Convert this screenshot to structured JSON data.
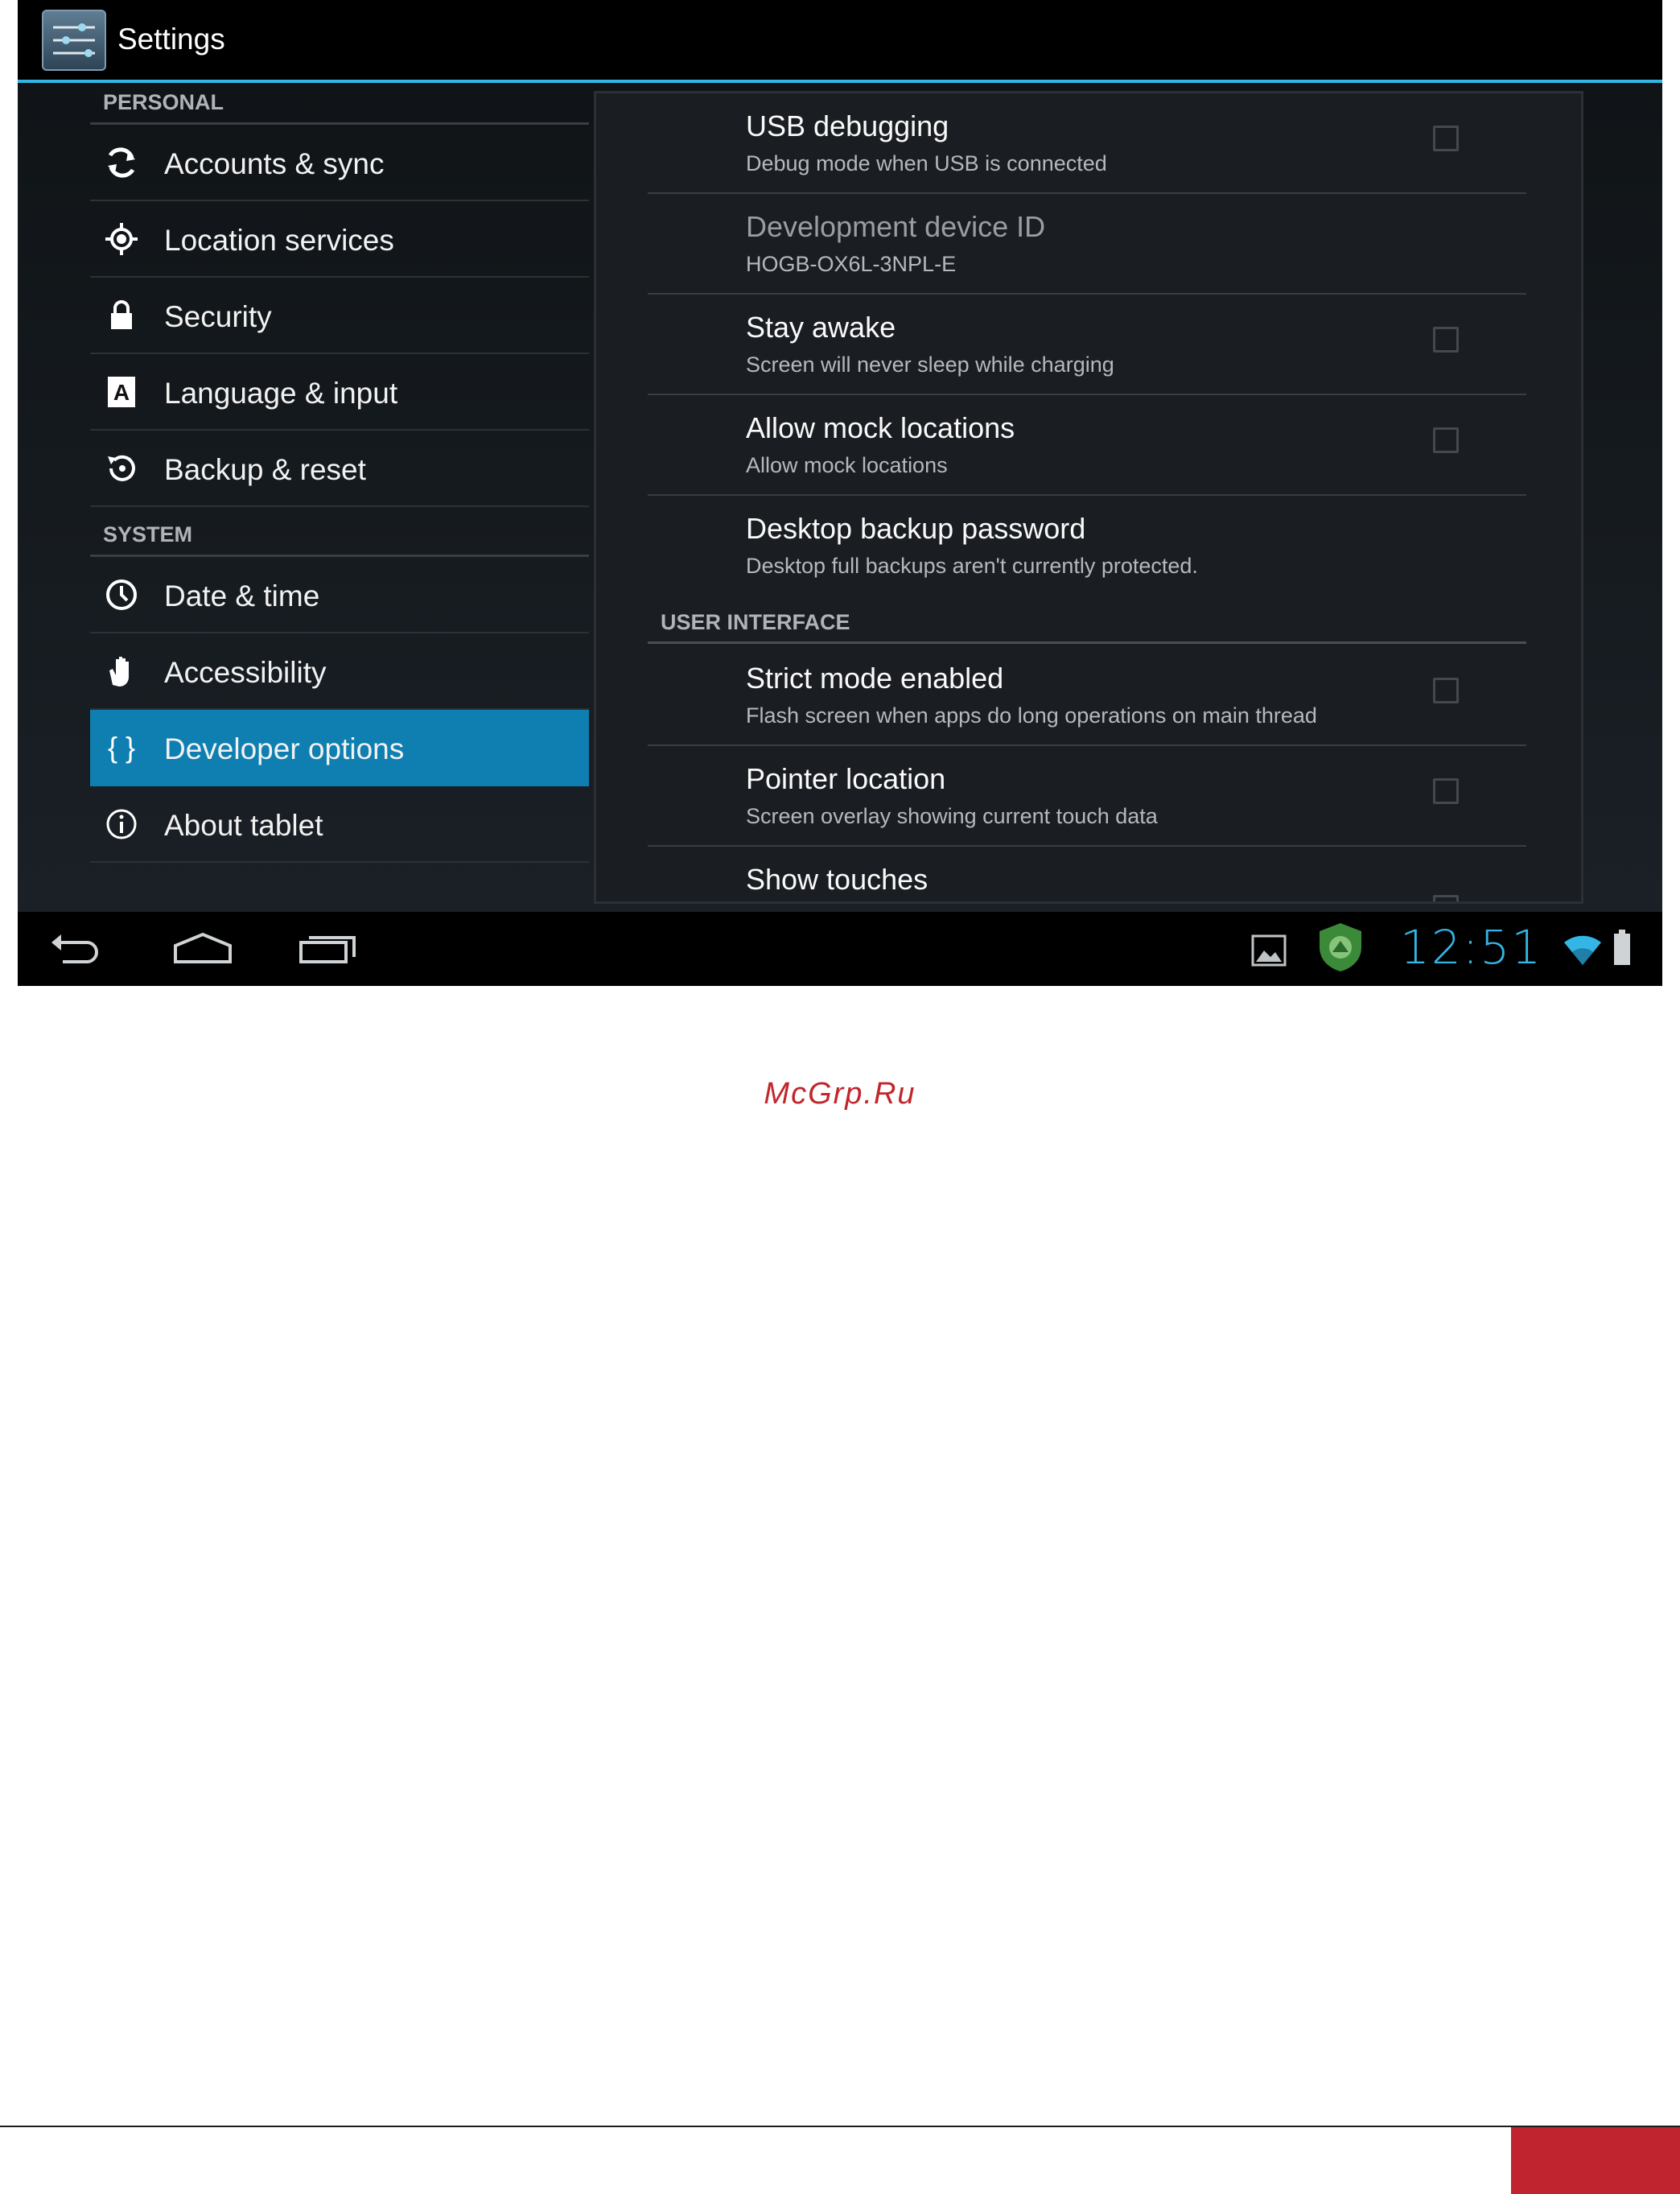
{
  "colors": {
    "accent": "#33b5e5",
    "selected": "#0e7fb0",
    "watermark": "#c0262c",
    "footer_block": "#c0242e"
  },
  "action_bar": {
    "icon": "settings-app-icon",
    "title": "Settings"
  },
  "sidebar": {
    "personal_header": "PERSONAL",
    "personal_items": [
      {
        "label": "Accounts & sync",
        "icon": "sync-icon"
      },
      {
        "label": "Location services",
        "icon": "location-icon"
      },
      {
        "label": "Security",
        "icon": "lock-icon"
      },
      {
        "label": "Language & input",
        "icon": "keyboard-icon"
      },
      {
        "label": "Backup & reset",
        "icon": "backup-icon"
      }
    ],
    "system_header": "SYSTEM",
    "system_items": [
      {
        "label": "Date & time",
        "icon": "clock-icon"
      },
      {
        "label": "Accessibility",
        "icon": "hand-icon"
      },
      {
        "label": "Developer options",
        "icon": "braces-icon",
        "selected": true,
        "glyph": "{ }"
      },
      {
        "label": "About tablet",
        "icon": "info-icon"
      }
    ]
  },
  "prefs": [
    {
      "title": "USB debugging",
      "summary": "Debug mode when USB is connected",
      "checkbox": true,
      "checked": false
    },
    {
      "title": "Development device ID",
      "summary": "HOGB-OX6L-3NPL-E",
      "checkbox": false,
      "disabled": true
    },
    {
      "title": "Stay awake",
      "summary": "Screen will never sleep while charging",
      "checkbox": true,
      "checked": false
    },
    {
      "title": "Allow mock locations",
      "summary": "Allow mock locations",
      "checkbox": true,
      "checked": false
    },
    {
      "title": "Desktop backup password",
      "summary": "Desktop full backups aren't currently protected.",
      "checkbox": false
    }
  ],
  "ui_header": "USER INTERFACE",
  "ui_prefs": [
    {
      "title": "Strict mode enabled",
      "summary": "Flash screen when apps do long operations on main thread",
      "checkbox": true,
      "checked": false
    },
    {
      "title": "Pointer location",
      "summary": "Screen overlay showing current touch data",
      "checkbox": true,
      "checked": false
    },
    {
      "title": "Show touches",
      "summary": "",
      "checkbox": true,
      "checked": false
    }
  ],
  "system_bar": {
    "clock": "12:51",
    "icons": [
      "back-icon",
      "home-icon",
      "recents-icon",
      "gallery-notification-icon",
      "shield-notification-icon",
      "wifi-icon",
      "battery-icon"
    ]
  },
  "watermark": "McGrp.Ru"
}
